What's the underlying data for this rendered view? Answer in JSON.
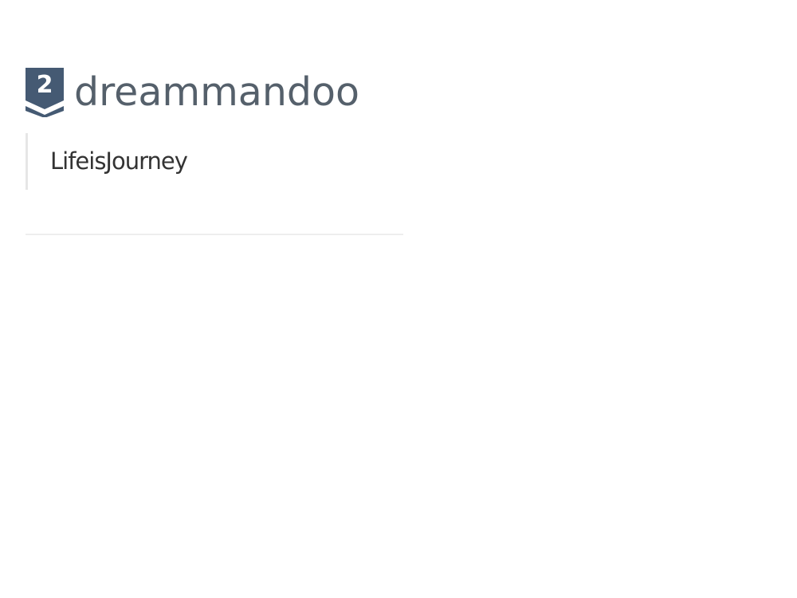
{
  "profile": {
    "rank_badge": {
      "number": "2",
      "color": "#455a73",
      "icon": "rank-badge-icon"
    },
    "username": "dreammandoo",
    "tagline": "LifeisJourney"
  },
  "colors": {
    "username_text": "#55606b",
    "tagline_text": "#333333",
    "divider": "#eeeeee",
    "background": "#ffffff"
  }
}
